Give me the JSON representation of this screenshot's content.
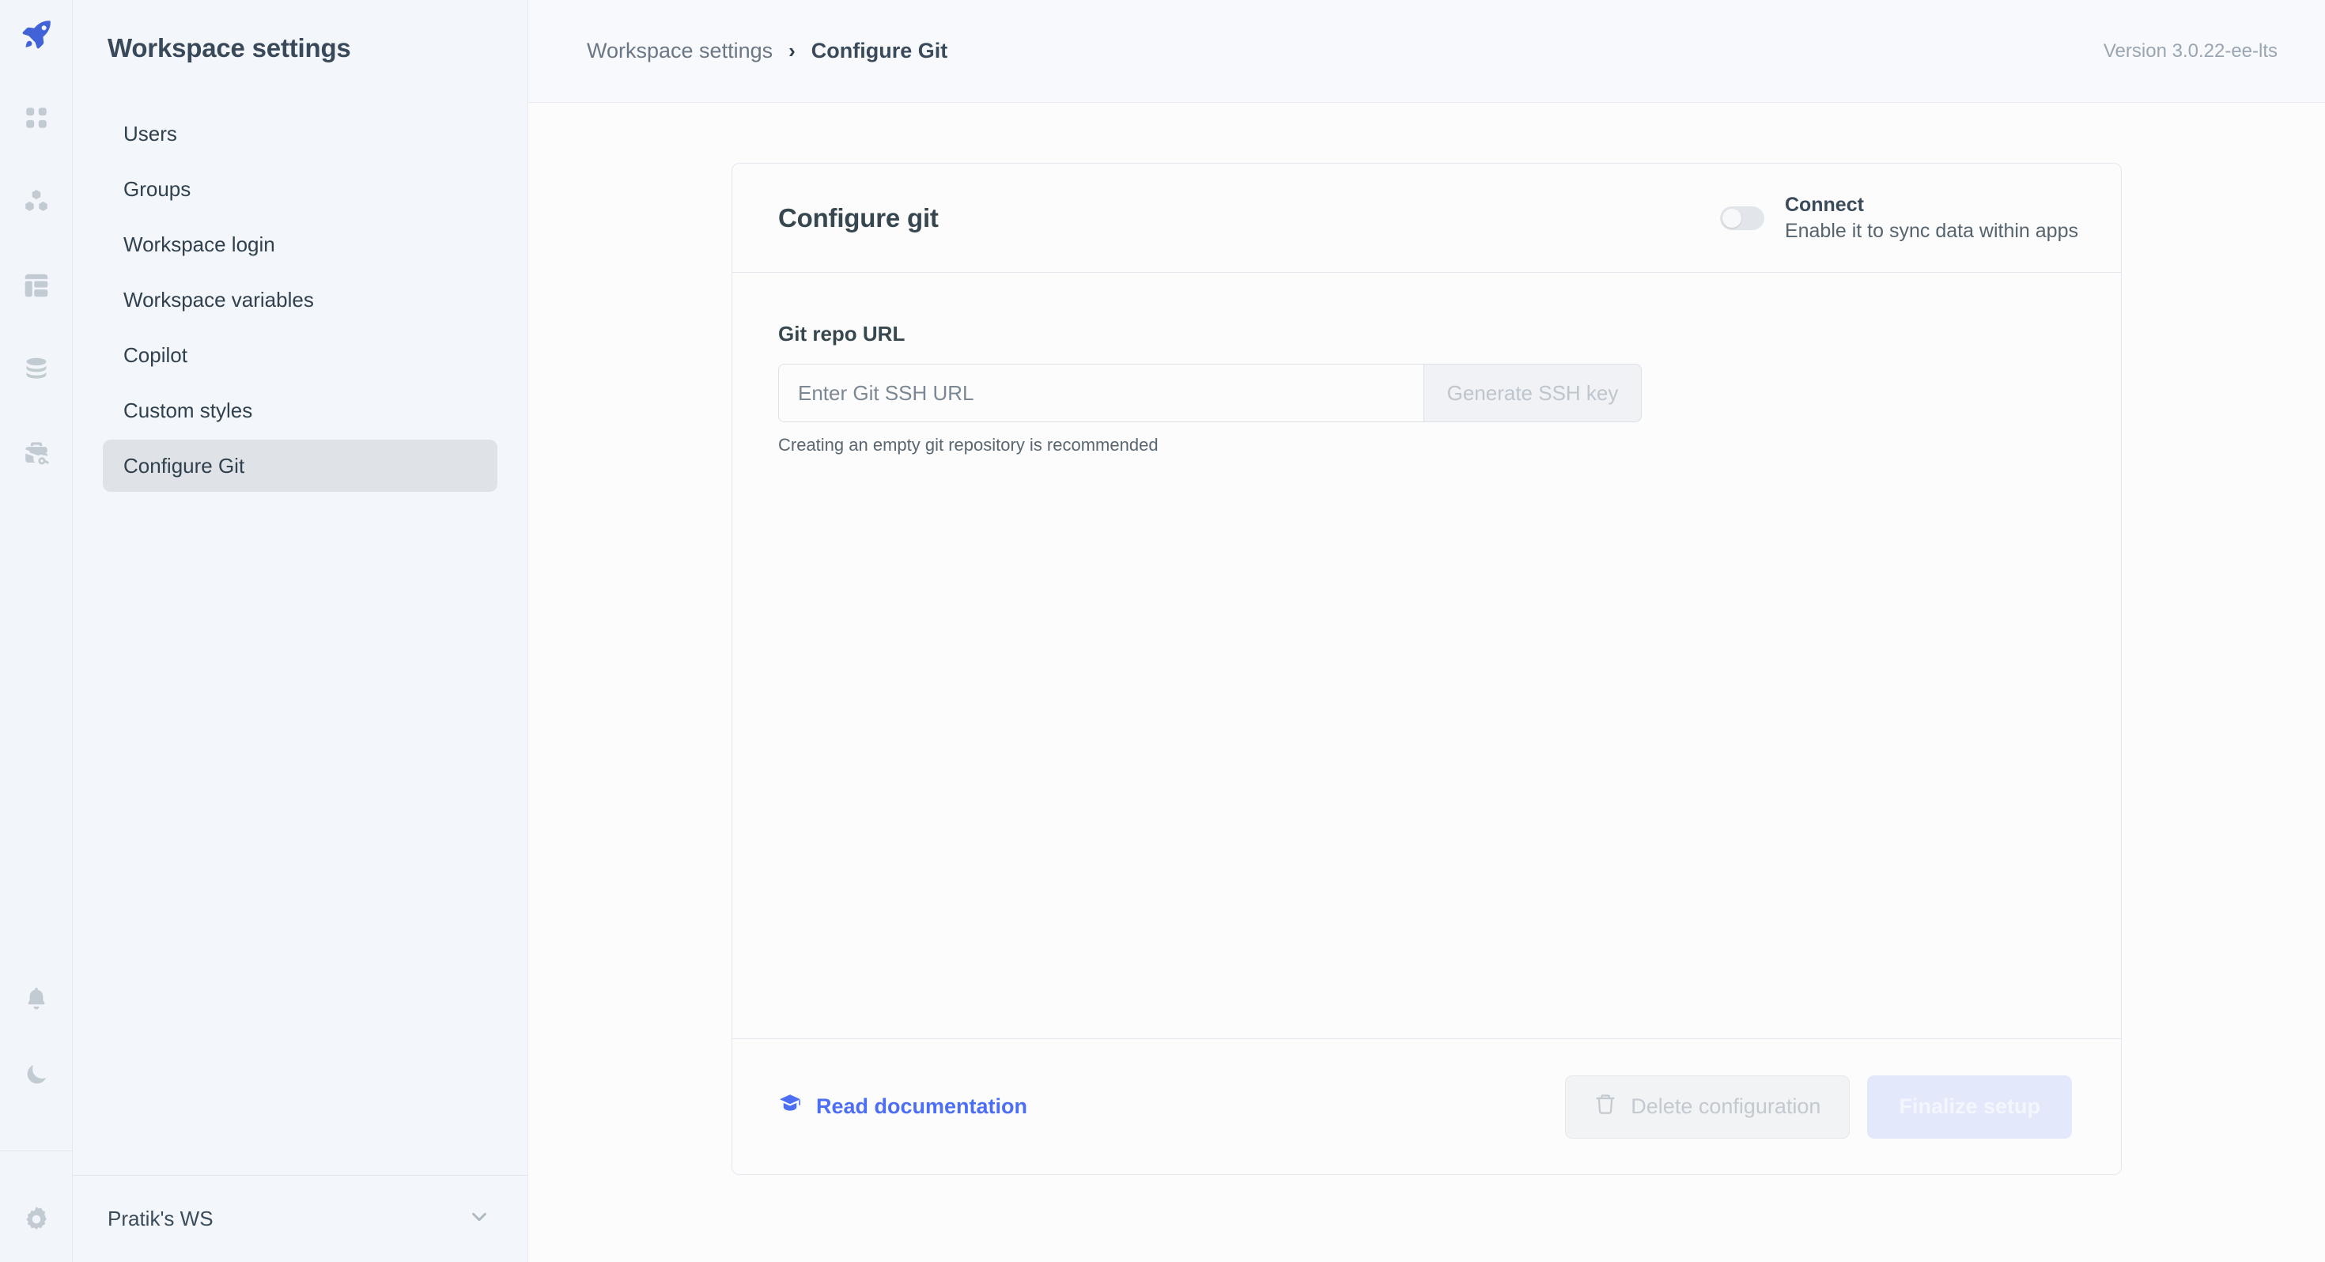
{
  "rail": {
    "logo_icon": "rocket-icon",
    "icons": [
      "grid-apps-icon",
      "hexagon-cluster-icon",
      "table-layout-icon",
      "database-stack-icon",
      "briefcase-key-icon"
    ],
    "bottom_icons": [
      "bell-icon",
      "moon-icon",
      "gear-icon"
    ],
    "accent": "#4263D8"
  },
  "sidebar": {
    "title": "Workspace settings",
    "items": [
      {
        "label": "Users",
        "active": false
      },
      {
        "label": "Groups",
        "active": false
      },
      {
        "label": "Workspace login",
        "active": false
      },
      {
        "label": "Workspace variables",
        "active": false
      },
      {
        "label": "Copilot",
        "active": false
      },
      {
        "label": "Custom styles",
        "active": false
      },
      {
        "label": "Configure Git",
        "active": true
      }
    ],
    "workspace": {
      "name": "Pratik's WS",
      "chevron_icon": "chevron-down-icon"
    }
  },
  "topbar": {
    "breadcrumb_root": "Workspace settings",
    "breadcrumb_separator": "›",
    "breadcrumb_current": "Configure Git",
    "version": "Version 3.0.22-ee-lts"
  },
  "card": {
    "title": "Configure git",
    "connect": {
      "label": "Connect",
      "description": "Enable it to sync data within apps",
      "enabled": false
    },
    "field": {
      "label": "Git repo URL",
      "value": "",
      "placeholder": "Enter Git SSH URL",
      "generate_button": "Generate SSH key",
      "hint": "Creating an empty git repository is recommended"
    },
    "footer": {
      "doc_link": "Read documentation",
      "doc_icon": "graduation-cap-icon",
      "delete_button": "Delete configuration",
      "delete_icon": "trash-icon",
      "finalize_button": "Finalize setup"
    }
  },
  "colors": {
    "accent_blue": "#4C6EF5",
    "sidebar_bg": "#F3F6FA",
    "card_bg": "#FCFCFD",
    "border": "#E3E8EE",
    "icon_gray": "#C2CBD2"
  }
}
